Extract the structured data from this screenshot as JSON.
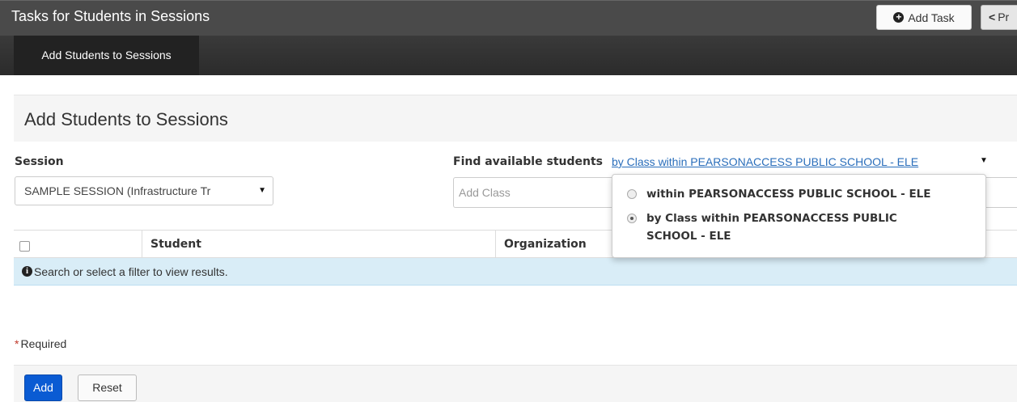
{
  "header": {
    "title": "Tasks for Students in Sessions",
    "add_task_label": "Add Task",
    "prev_label": "Pr"
  },
  "subnav": {
    "active_tab": "Add Students to Sessions"
  },
  "panel": {
    "title": "Add Students to Sessions"
  },
  "form": {
    "session_label": "Session",
    "session_value": "SAMPLE SESSION (Infrastructure Tr",
    "find_label": "Find available students",
    "filter_link": "by Class within PEARSONACCESS PUBLIC SCHOOL - ELE",
    "class_placeholder": "Add Class"
  },
  "dropdown": {
    "options": [
      {
        "label": "within PEARSONACCESS PUBLIC SCHOOL - ELE",
        "selected": false
      },
      {
        "label_line1": "by Class within PEARSONACCESS PUBLIC",
        "label_line2": "SCHOOL - ELE",
        "selected": true
      }
    ]
  },
  "table": {
    "columns": [
      "Student",
      "Organization"
    ],
    "empty_message": "Search or select a filter to view results."
  },
  "footer": {
    "required_note": "Required",
    "add_label": "Add",
    "reset_label": "Reset"
  },
  "icons": {
    "add_task": "plus-circle-icon",
    "prev": "chevron-left-icon",
    "info": "info-circle-icon",
    "caret": "caret-down-icon"
  },
  "colors": {
    "primary_button": "#0a5bd3",
    "link": "#2a6ebb",
    "info_row": "#d9edf7",
    "topbar": "#4a4a4a"
  }
}
